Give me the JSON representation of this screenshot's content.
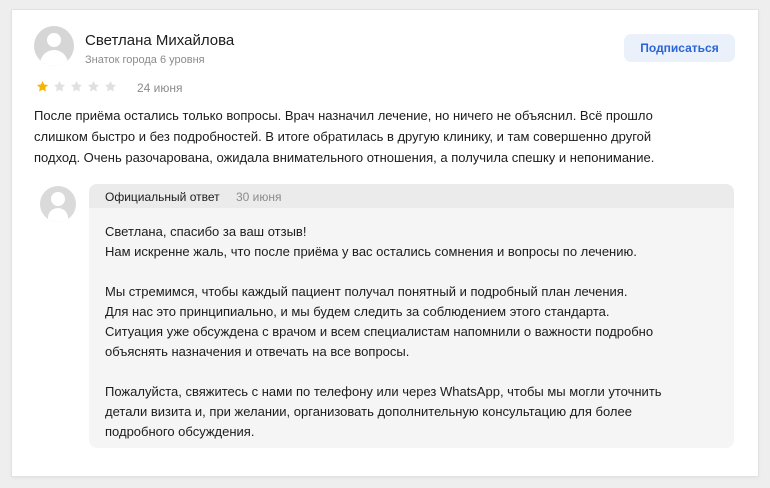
{
  "author": {
    "name": "Светлана Михайлова",
    "level": "Знаток города 6 уровня",
    "subscribe_label": "Подписаться"
  },
  "review": {
    "rating": 1,
    "max_rating": 5,
    "date": "24 июня",
    "lines": [
      "После приёма остались только вопросы. Врач назначил лечение, но ничего не объяснил. Всё прошло",
      "слишком быстро и без подробностей. В итоге обратилась в другую клинику, и там совершенно другой",
      "подход. Очень разочарована, ожидала внимательного отношения, а получила спешку и непонимание."
    ]
  },
  "reply": {
    "label": "Официальный ответ",
    "date": "30 июня",
    "paragraphs": [
      [
        "Светлана, спасибо за ваш отзыв!",
        "Нам искренне жаль, что после приёма у вас остались сомнения и вопросы по лечению."
      ],
      [
        "Мы стремимся, чтобы каждый пациент получал понятный и подробный план лечения.",
        "Для нас это принципиально, и мы будем следить за соблюдением этого стандарта.",
        "Ситуация уже обсуждена с врачом и всем специалистам напомнили о важности подробно",
        "объяснять назначения и отвечать на все вопросы."
      ],
      [
        "Пожалуйста, свяжитесь с нами по телефону или через WhatsApp, чтобы мы могли уточнить",
        "детали визита и, при желании, организовать дополнительную консультацию для более",
        "подробного обсуждения."
      ]
    ]
  },
  "colors": {
    "star_filled": "#f7b500",
    "star_empty": "#e0e0e0",
    "accent": "#2a64d6"
  },
  "icons": {
    "user_avatar": "user-avatar-icon",
    "company_avatar": "company-avatar-icon",
    "star": "star-icon"
  }
}
